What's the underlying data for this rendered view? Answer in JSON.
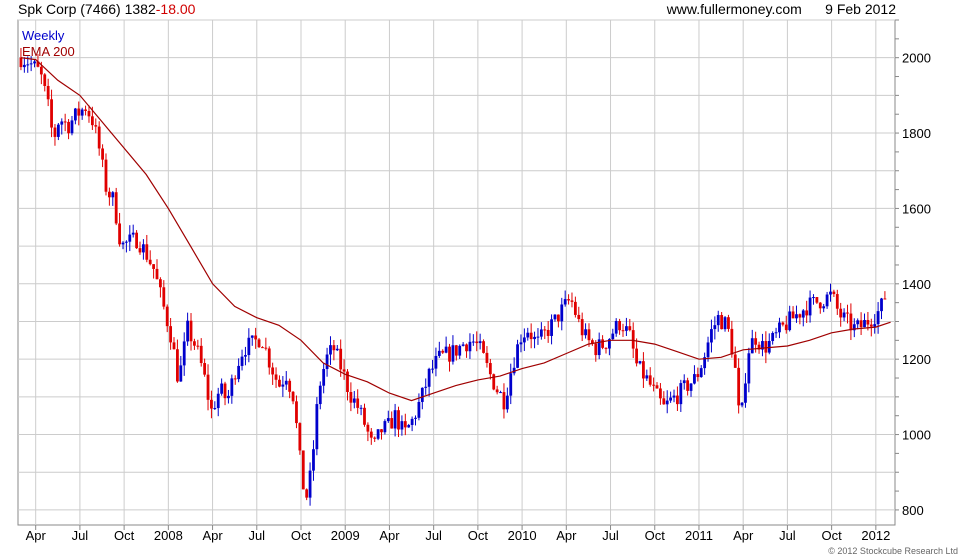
{
  "header": {
    "company": "Spk Corp (7466)",
    "last_price": "1382",
    "change": "-18.00",
    "source": "www.fullermoney.com",
    "date": "9 Feb 2012"
  },
  "legend": {
    "period": "Weekly",
    "ema": "EMA 200"
  },
  "copyright": "© 2012 Stockcube Research Ltd",
  "colors": {
    "up": "#0000cc",
    "down": "#e00000",
    "ema": "#a00000",
    "grid": "#cccccc"
  },
  "chart_data": {
    "type": "candlestick-weekly",
    "ylim": [
      760,
      2100
    ],
    "xlim_months": [
      -1.2,
      58.3
    ],
    "x_month_origin": "Apr 2007",
    "yticks": [
      800,
      1000,
      1200,
      1400,
      1600,
      1800,
      2000
    ],
    "xticks": [
      {
        "label": "Apr",
        "m": 0
      },
      {
        "label": "Jul",
        "m": 3
      },
      {
        "label": "Oct",
        "m": 6
      },
      {
        "label": "2008",
        "m": 9
      },
      {
        "label": "Apr",
        "m": 12
      },
      {
        "label": "Jul",
        "m": 15
      },
      {
        "label": "Oct",
        "m": 18
      },
      {
        "label": "2009",
        "m": 21
      },
      {
        "label": "Apr",
        "m": 24
      },
      {
        "label": "Jul",
        "m": 27
      },
      {
        "label": "Oct",
        "m": 30
      },
      {
        "label": "2010",
        "m": 33
      },
      {
        "label": "Apr",
        "m": 36
      },
      {
        "label": "Jul",
        "m": 39
      },
      {
        "label": "Oct",
        "m": 42
      },
      {
        "label": "2011",
        "m": 45
      },
      {
        "label": "Apr",
        "m": 48
      },
      {
        "label": "Jul",
        "m": 51
      },
      {
        "label": "Oct",
        "m": 54
      },
      {
        "label": "2012",
        "m": 57
      }
    ],
    "price_path": [
      [
        -1.0,
        2000
      ],
      [
        -0.5,
        1990
      ],
      [
        0.3,
        1960
      ],
      [
        0.8,
        1880
      ],
      [
        1.2,
        1780
      ],
      [
        1.6,
        1840
      ],
      [
        2.2,
        1820
      ],
      [
        2.8,
        1850
      ],
      [
        3.4,
        1870
      ],
      [
        3.9,
        1830
      ],
      [
        4.3,
        1760
      ],
      [
        4.8,
        1650
      ],
      [
        5.3,
        1620
      ],
      [
        5.8,
        1500
      ],
      [
        6.3,
        1510
      ],
      [
        6.9,
        1520
      ],
      [
        7.5,
        1480
      ],
      [
        8.0,
        1440
      ],
      [
        8.6,
        1350
      ],
      [
        9.2,
        1260
      ],
      [
        9.7,
        1140
      ],
      [
        10.3,
        1280
      ],
      [
        10.9,
        1230
      ],
      [
        11.4,
        1160
      ],
      [
        11.9,
        1060
      ],
      [
        12.5,
        1120
      ],
      [
        13.0,
        1090
      ],
      [
        13.6,
        1180
      ],
      [
        14.1,
        1230
      ],
      [
        14.7,
        1240
      ],
      [
        15.3,
        1260
      ],
      [
        15.9,
        1190
      ],
      [
        16.5,
        1130
      ],
      [
        17.0,
        1160
      ],
      [
        17.5,
        1100
      ],
      [
        17.9,
        940
      ],
      [
        18.3,
        820
      ],
      [
        18.7,
        900
      ],
      [
        19.2,
        1120
      ],
      [
        19.7,
        1200
      ],
      [
        20.2,
        1230
      ],
      [
        20.8,
        1170
      ],
      [
        21.3,
        1110
      ],
      [
        21.9,
        1070
      ],
      [
        22.4,
        1020
      ],
      [
        22.9,
        960
      ],
      [
        23.4,
        1010
      ],
      [
        23.9,
        1020
      ],
      [
        24.4,
        1050
      ],
      [
        25.0,
        1000
      ],
      [
        25.6,
        1040
      ],
      [
        26.2,
        1100
      ],
      [
        26.7,
        1160
      ],
      [
        27.3,
        1200
      ],
      [
        27.8,
        1210
      ],
      [
        28.4,
        1220
      ],
      [
        29.0,
        1240
      ],
      [
        29.6,
        1250
      ],
      [
        30.1,
        1230
      ],
      [
        30.7,
        1170
      ],
      [
        31.3,
        1120
      ],
      [
        31.8,
        1090
      ],
      [
        32.3,
        1180
      ],
      [
        32.9,
        1260
      ],
      [
        33.4,
        1280
      ],
      [
        34.0,
        1240
      ],
      [
        34.6,
        1270
      ],
      [
        35.2,
        1300
      ],
      [
        35.7,
        1330
      ],
      [
        36.3,
        1360
      ],
      [
        36.9,
        1290
      ],
      [
        37.4,
        1250
      ],
      [
        38.0,
        1230
      ],
      [
        38.6,
        1240
      ],
      [
        39.1,
        1270
      ],
      [
        39.7,
        1300
      ],
      [
        40.3,
        1260
      ],
      [
        40.8,
        1180
      ],
      [
        41.4,
        1150
      ],
      [
        42.0,
        1110
      ],
      [
        42.6,
        1070
      ],
      [
        43.1,
        1090
      ],
      [
        43.7,
        1110
      ],
      [
        44.2,
        1130
      ],
      [
        44.8,
        1150
      ],
      [
        45.3,
        1200
      ],
      [
        45.8,
        1270
      ],
      [
        46.3,
        1310
      ],
      [
        46.9,
        1290
      ],
      [
        47.4,
        1200
      ],
      [
        47.8,
        1010
      ],
      [
        48.3,
        1220
      ],
      [
        48.8,
        1260
      ],
      [
        49.4,
        1230
      ],
      [
        50.0,
        1250
      ],
      [
        50.6,
        1280
      ],
      [
        51.1,
        1300
      ],
      [
        51.7,
        1320
      ],
      [
        52.3,
        1340
      ],
      [
        52.9,
        1350
      ],
      [
        53.5,
        1360
      ],
      [
        54.0,
        1370
      ],
      [
        54.5,
        1320
      ],
      [
        55.0,
        1300
      ],
      [
        55.6,
        1280
      ],
      [
        56.1,
        1290
      ],
      [
        56.7,
        1310
      ],
      [
        57.3,
        1330
      ],
      [
        57.8,
        1390
      ]
    ],
    "ema_path": [
      [
        -1.0,
        2000
      ],
      [
        0.0,
        1995
      ],
      [
        1.5,
        1940
      ],
      [
        3.0,
        1900
      ],
      [
        4.5,
        1830
      ],
      [
        6.0,
        1760
      ],
      [
        7.5,
        1690
      ],
      [
        9.0,
        1600
      ],
      [
        10.5,
        1500
      ],
      [
        12.0,
        1400
      ],
      [
        13.5,
        1340
      ],
      [
        15.0,
        1310
      ],
      [
        16.5,
        1290
      ],
      [
        18.0,
        1250
      ],
      [
        19.5,
        1190
      ],
      [
        21.0,
        1160
      ],
      [
        22.5,
        1140
      ],
      [
        24.0,
        1110
      ],
      [
        25.5,
        1090
      ],
      [
        27.0,
        1110
      ],
      [
        28.5,
        1130
      ],
      [
        30.0,
        1145
      ],
      [
        31.5,
        1155
      ],
      [
        33.0,
        1175
      ],
      [
        34.5,
        1190
      ],
      [
        36.0,
        1215
      ],
      [
        37.5,
        1240
      ],
      [
        39.0,
        1250
      ],
      [
        40.5,
        1250
      ],
      [
        42.0,
        1240
      ],
      [
        43.5,
        1220
      ],
      [
        45.0,
        1200
      ],
      [
        46.5,
        1205
      ],
      [
        48.0,
        1225
      ],
      [
        49.5,
        1230
      ],
      [
        51.0,
        1235
      ],
      [
        52.5,
        1250
      ],
      [
        54.0,
        1270
      ],
      [
        55.5,
        1280
      ],
      [
        57.0,
        1285
      ],
      [
        58.0,
        1298
      ]
    ]
  }
}
